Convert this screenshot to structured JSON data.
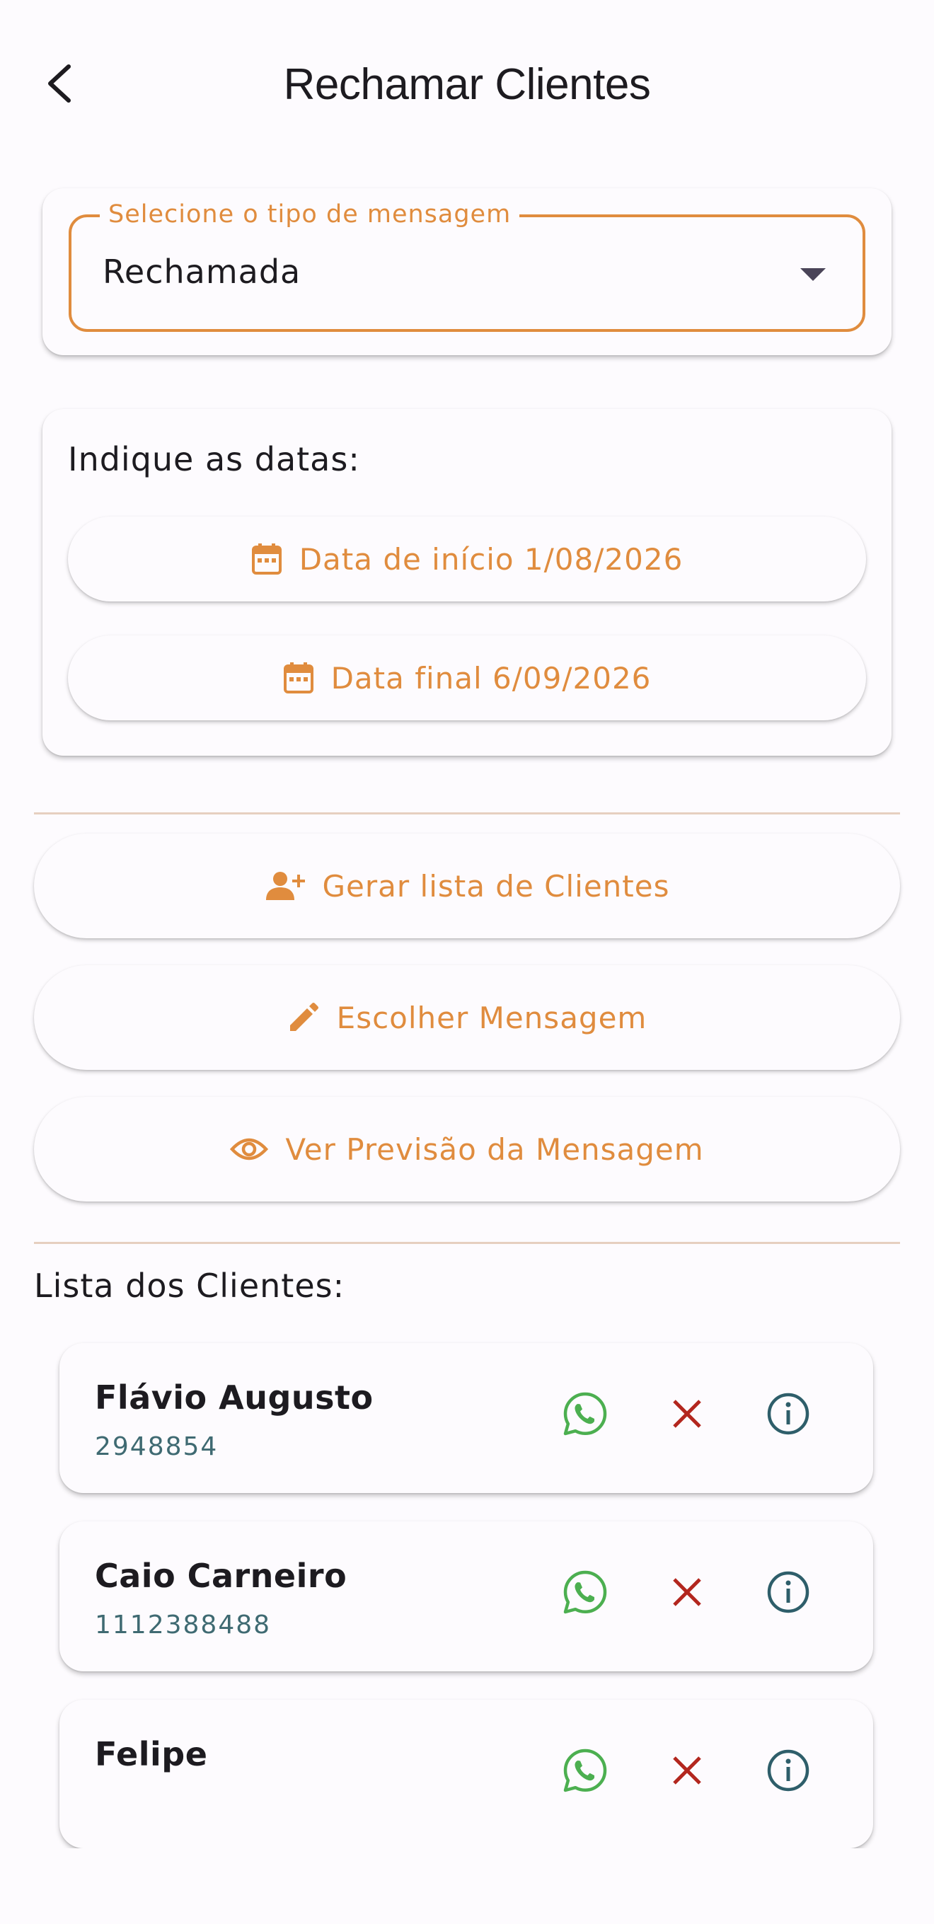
{
  "header": {
    "title": "Rechamar Clientes",
    "back_icon": "arrow-back-icon"
  },
  "message_type": {
    "label": "Selecione o tipo de mensagem",
    "selected": "Rechamada"
  },
  "dates": {
    "label": "Indique as datas:",
    "start_button": "Data de início 1/08/2026",
    "end_button": "Data final 6/09/2026"
  },
  "actions": {
    "generate_list": "Gerar lista de Clientes",
    "choose_message": "Escolher Mensagem",
    "preview_message": "Ver Previsão da Mensagem"
  },
  "client_list": {
    "title": "Lista dos Clientes:",
    "clients": [
      {
        "name": "Flávio Augusto",
        "phone": "2948854"
      },
      {
        "name": "Caio Carneiro",
        "phone": "1112388488"
      },
      {
        "name": "Felipe",
        "phone": ""
      }
    ]
  },
  "colors": {
    "accent": "#e08c3e",
    "whatsapp": "#4caf50",
    "remove": "#b3261e",
    "info": "#2e5e6a",
    "background": "#fdfbfe"
  }
}
